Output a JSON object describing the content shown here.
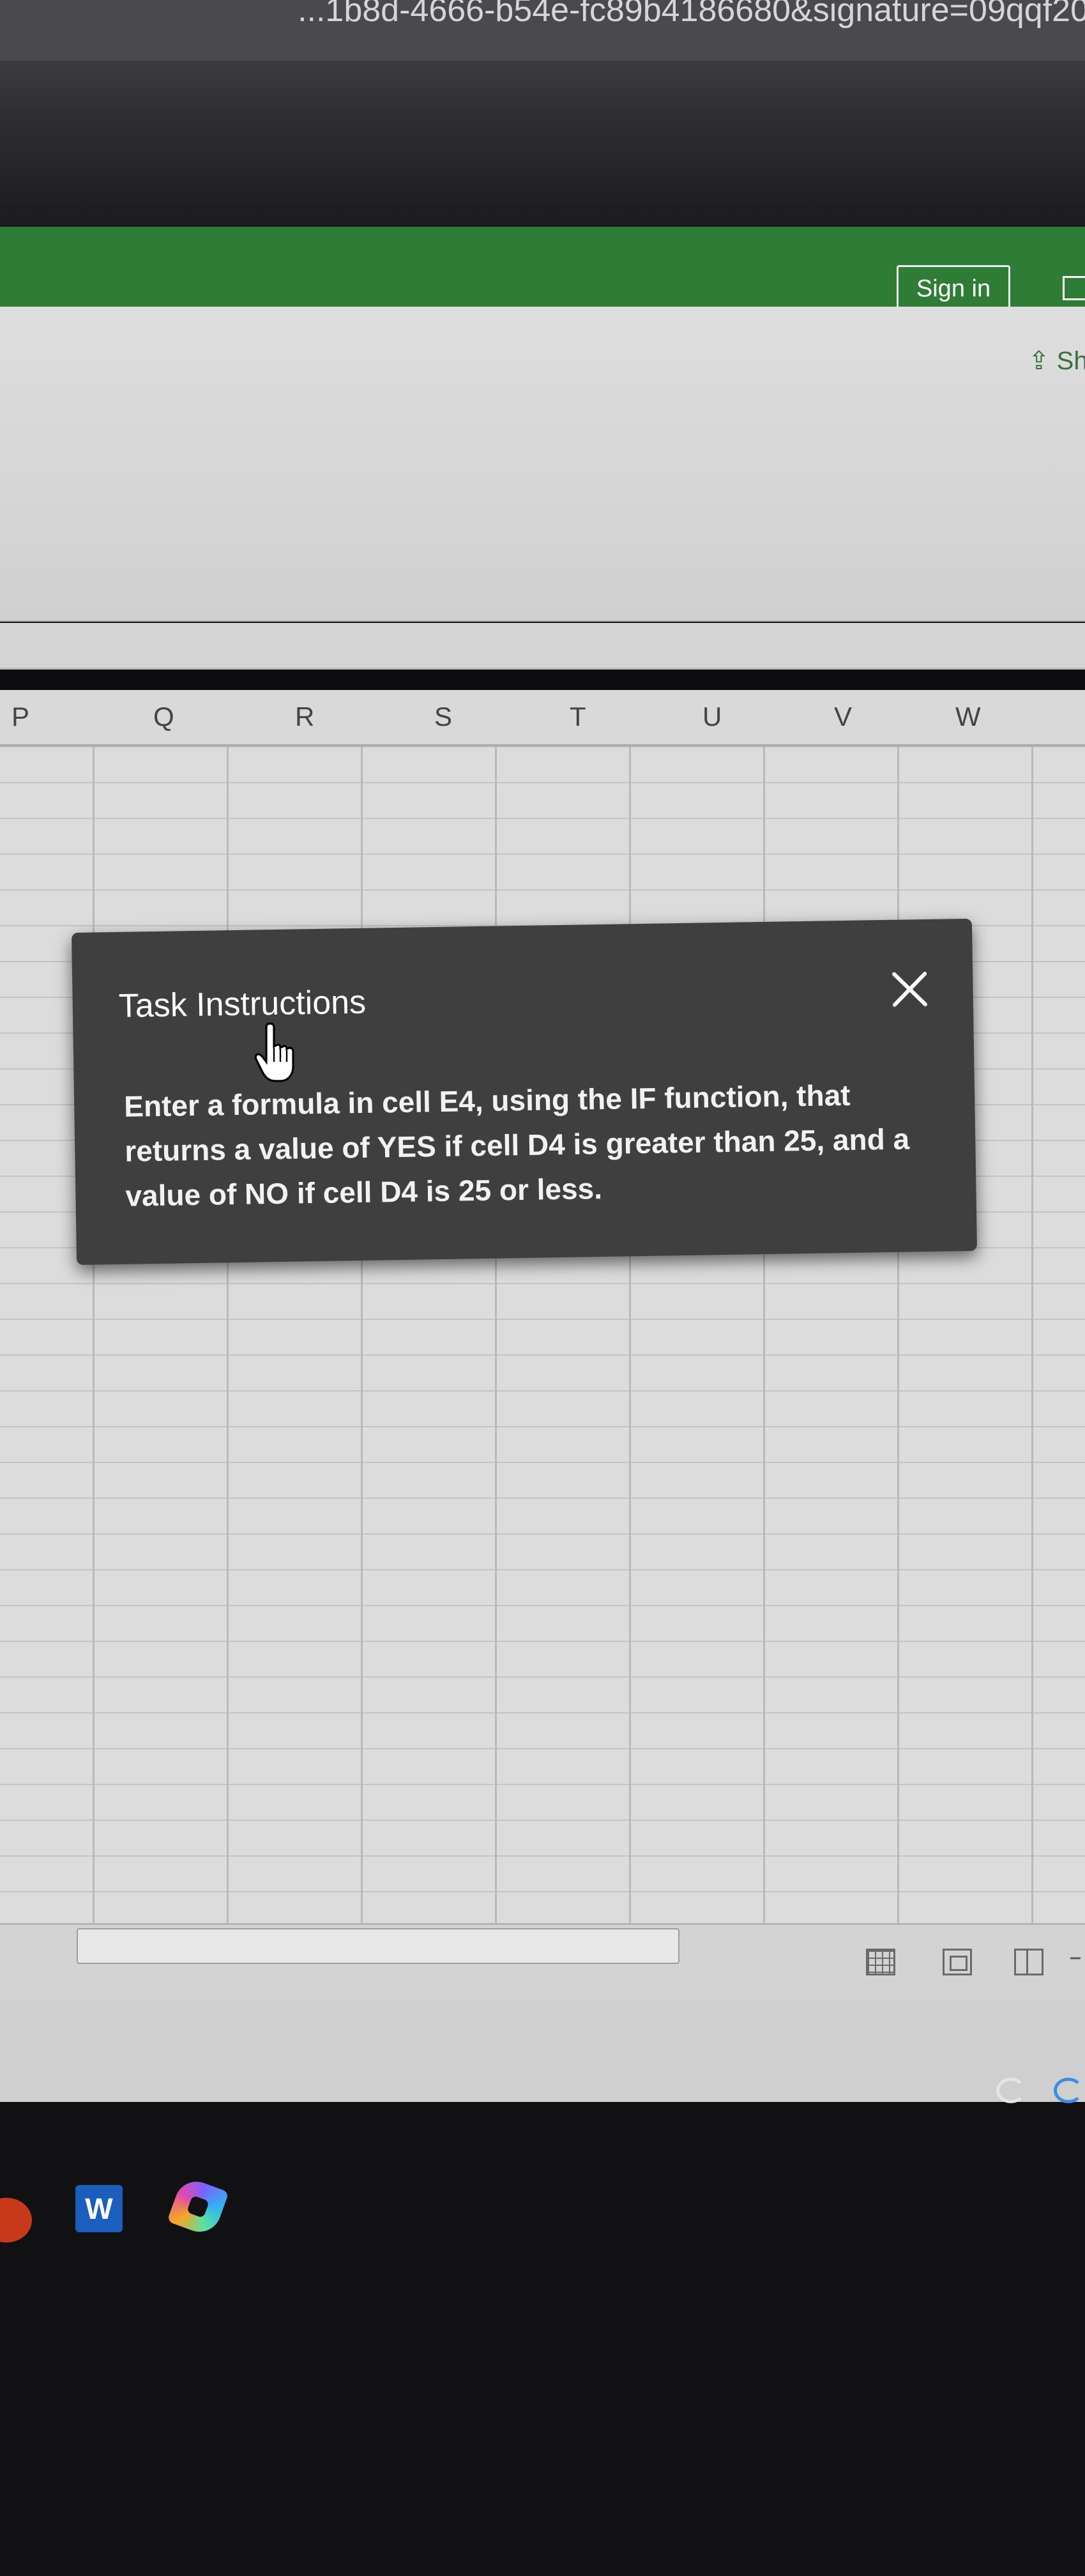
{
  "browser": {
    "url_fragment": "...1b8d-4666-b54e-fc89b4186680&signature=09qqf20"
  },
  "header": {
    "sign_in_label": "Sign in",
    "share_label": "Sh"
  },
  "columns": [
    "P",
    "Q",
    "R",
    "S",
    "T",
    "U",
    "V",
    "W"
  ],
  "dialog": {
    "title": "Task Instructions",
    "body": "Enter a formula in cell E4, using the IF function, that returns a value of YES if cell D4 is greater than 25, and a value of NO if cell D4 is 25 or less."
  },
  "taskbar": {
    "word_label": "W"
  },
  "colors": {
    "excel_green": "#2f7c36",
    "dialog_bg": "#3f3f3f",
    "word_blue": "#1b5ebd"
  },
  "icons": [
    "close-icon",
    "hand-cursor-icon",
    "share-icon",
    "normal-view-icon",
    "page-layout-view-icon",
    "page-break-view-icon",
    "onedrive-cloud-icon",
    "word-app-icon",
    "copilot-app-icon"
  ]
}
